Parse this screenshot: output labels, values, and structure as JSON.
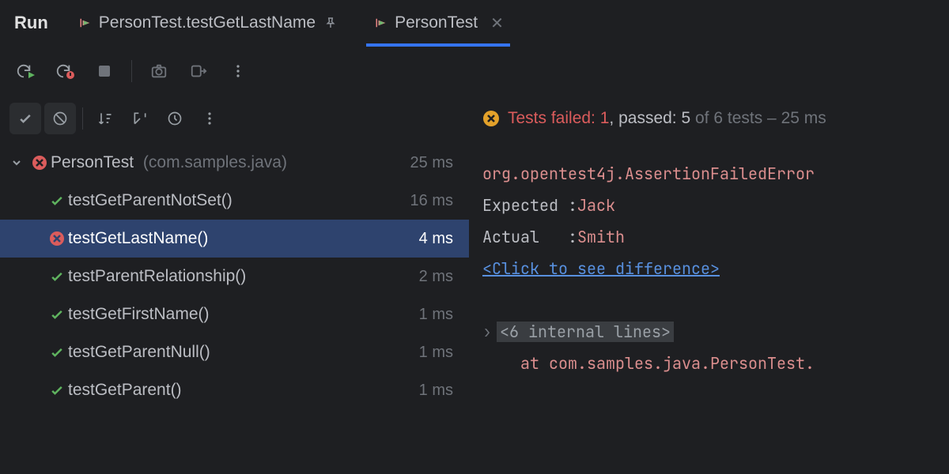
{
  "header": {
    "run_label": "Run",
    "tabs": [
      {
        "label": "PersonTest.testGetLastName",
        "active": false,
        "pinned": true,
        "closable": false
      },
      {
        "label": "PersonTest",
        "active": true,
        "pinned": false,
        "closable": true
      }
    ]
  },
  "summary": {
    "failed_prefix": "Tests failed: ",
    "failed_count": "1",
    "passed_prefix": ", passed: ",
    "passed_count": "5",
    "tail": " of 6 tests – 25 ms"
  },
  "tree": {
    "root": {
      "name": "PersonTest",
      "pkg": "(com.samples.java)",
      "duration": "25 ms",
      "status": "fail"
    },
    "children": [
      {
        "name": "testGetParentNotSet()",
        "duration": "16 ms",
        "status": "pass"
      },
      {
        "name": "testGetLastName()",
        "duration": "4 ms",
        "status": "fail",
        "selected": true
      },
      {
        "name": "testParentRelationship()",
        "duration": "2 ms",
        "status": "pass"
      },
      {
        "name": "testGetFirstName()",
        "duration": "1 ms",
        "status": "pass"
      },
      {
        "name": "testGetParentNull()",
        "duration": "1 ms",
        "status": "pass"
      },
      {
        "name": "testGetParent()",
        "duration": "1 ms",
        "status": "pass"
      }
    ]
  },
  "console": {
    "error_class": "org.opentest4j.AssertionFailedError",
    "expected_label": "Expected :",
    "expected_value": "Jack",
    "actual_label": "Actual   :",
    "actual_value": "Smith",
    "diff_link": "<Click to see difference>",
    "fold_label": "<6 internal lines>",
    "stack_line": "at com.samples.java.PersonTest."
  }
}
